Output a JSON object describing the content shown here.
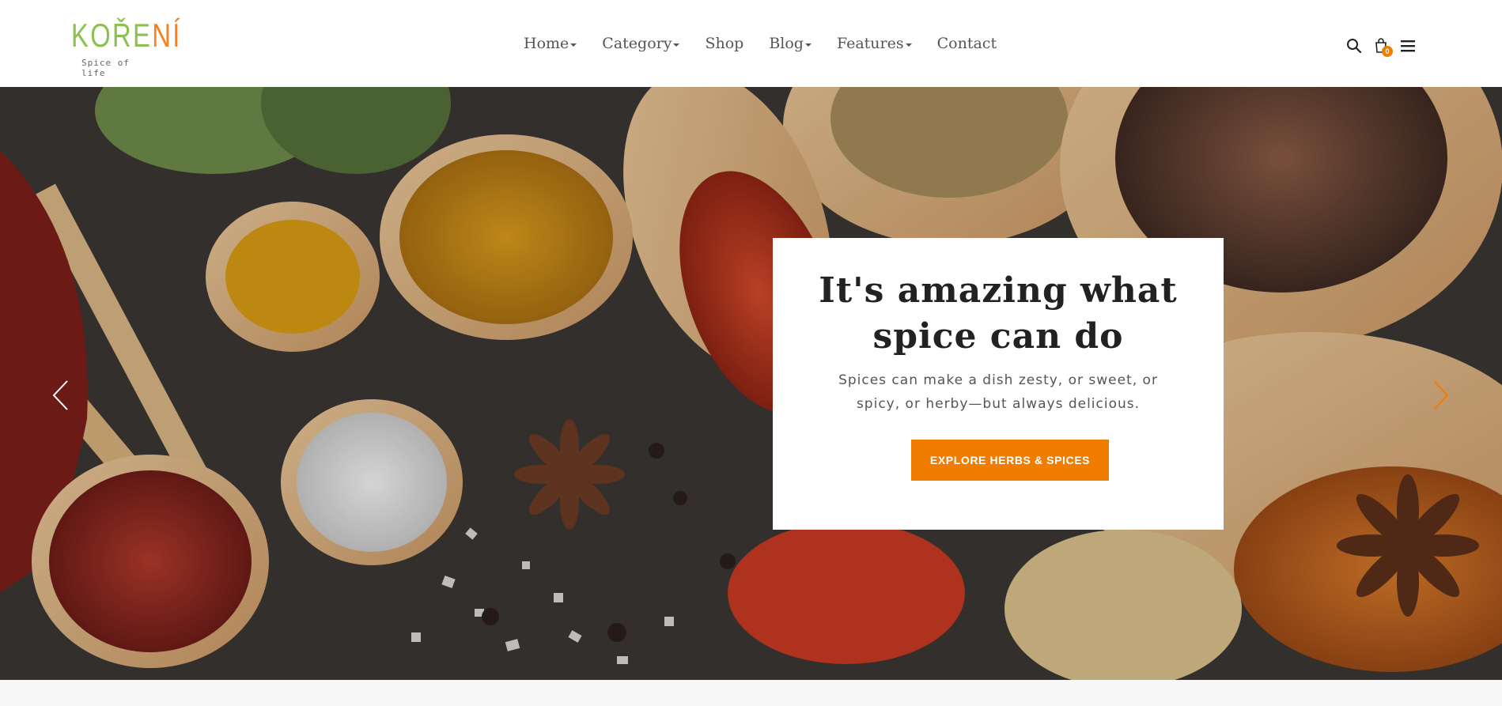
{
  "logo": {
    "word_part1": "KOŘE",
    "word_part2": "NÍ",
    "tagline": "Spice of life"
  },
  "nav": {
    "items": [
      {
        "label": "Home",
        "has_dropdown": true
      },
      {
        "label": "Category",
        "has_dropdown": true
      },
      {
        "label": "Shop",
        "has_dropdown": false
      },
      {
        "label": "Blog",
        "has_dropdown": true
      },
      {
        "label": "Features",
        "has_dropdown": true
      },
      {
        "label": "Contact",
        "has_dropdown": false
      }
    ]
  },
  "header_icons": {
    "search": "search-icon",
    "cart": "shopping-bag-icon",
    "cart_count": "0",
    "menu": "hamburger-menu-icon"
  },
  "hero": {
    "title": "It's amazing what spice can do",
    "description": "Spices can make a dish zesty, or sweet, or spicy, or herby—but always delicious.",
    "button_label": "EXPLORE HERBS & SPICES",
    "prev_icon": "chevron-left-icon",
    "next_icon": "chevron-right-icon"
  },
  "colors": {
    "accent": "#f07c00",
    "logo_green": "#8cc152",
    "logo_orange": "#f58220",
    "text_dark": "#222222",
    "nav_text": "#555555"
  }
}
